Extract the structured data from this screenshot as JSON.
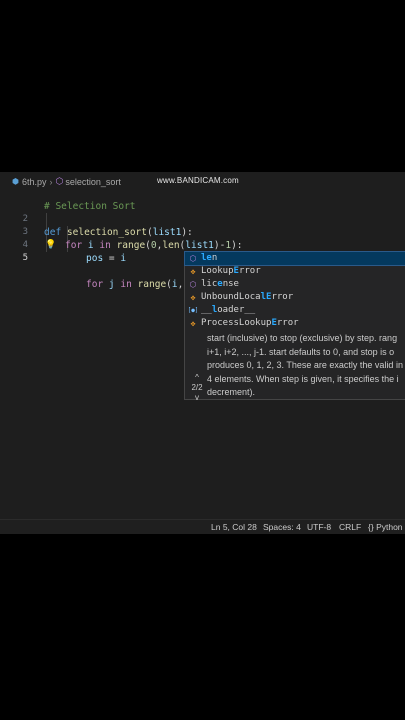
{
  "watermark": "www.BANDICAM.com",
  "breadcrumb": {
    "file": "6th.py",
    "symbol": "selection_sort"
  },
  "editor": {
    "line_numbers": [
      "2",
      "3",
      "4",
      "5"
    ],
    "line1": {
      "comment": "# Selection Sort"
    },
    "line2": {
      "kw": "def",
      "fn": "selection_sort",
      "open": "(",
      "param": "list1",
      "close": "):"
    },
    "line3": {
      "kw_for": "for",
      "var_i": "i",
      "kw_in": "in",
      "fn_range": "range",
      "p1": "(",
      "num0": "0",
      "comma": ",",
      "fn_len": "len",
      "p2": "(",
      "arg": "list1",
      "p3": ")-",
      "num1": "1",
      "p4": "):"
    },
    "line4": {
      "var_pos": "pos",
      "eq": " = ",
      "var_i": "i"
    },
    "line5": {
      "kw_for": "for",
      "var_j": "j",
      "kw_in": "in",
      "fn_range": "range",
      "p1": "(",
      "var_i": "i",
      "rest": ",le)"
    }
  },
  "suggestions": [
    {
      "icon": "cube-icon",
      "match": "le",
      "rest": "n",
      "selected": true
    },
    {
      "icon": "class-icon",
      "pre": "Lookup",
      "match": "E",
      "rest": "rror"
    },
    {
      "icon": "cube-icon",
      "pre": "lic",
      "match": "e",
      "rest": "nse"
    },
    {
      "icon": "class-icon",
      "pre": "UnboundLoca",
      "match": "lE",
      "rest": "rror"
    },
    {
      "icon": "field-icon",
      "pre": "__",
      "match": "l",
      "rest": "oad",
      "post": "er__"
    },
    {
      "icon": "class-icon",
      "pre": "ProcessLookup",
      "match": "E",
      "rest": "rror"
    }
  ],
  "doc": {
    "lines": [
      "start (inclusive) to stop (exclusive) by step. rang",
      "i+1, i+2, ..., j-1. start defaults to 0, and stop is o",
      "produces 0, 1, 2, 3. These are exactly the valid in",
      "4 elements. When step is given, it specifies the i",
      "decrement)."
    ],
    "counter": "2/2"
  },
  "statusbar": {
    "position": "Ln 5, Col 28",
    "spaces": "Spaces: 4",
    "encoding": "UTF-8",
    "eol": "CRLF",
    "language": "Python"
  }
}
